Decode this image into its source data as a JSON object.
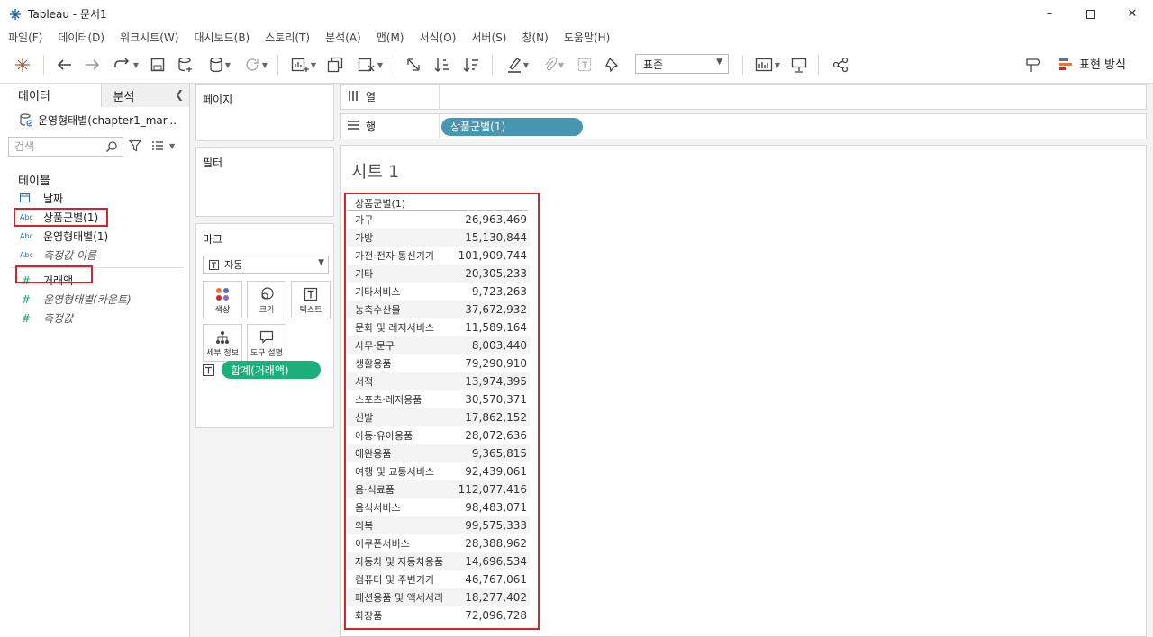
{
  "window": {
    "title": "Tableau - 문서1"
  },
  "menu": [
    "파일(F)",
    "데이터(D)",
    "워크시트(W)",
    "대시보드(B)",
    "스토리(T)",
    "분석(A)",
    "맵(M)",
    "서식(O)",
    "서버(S)",
    "창(N)",
    "도움말(H)"
  ],
  "toolbar": {
    "standard_select": "표준",
    "presentation_label": "표현 방식"
  },
  "data_pane": {
    "tabs": {
      "data": "데이터",
      "analysis": "분석"
    },
    "datasource": "운영형태별(chapter1_mar...",
    "search_placeholder": "검색",
    "tables_title": "테이블",
    "dimensions": [
      {
        "type": "date",
        "type_label": "",
        "name": "날짜"
      },
      {
        "type": "abc",
        "type_label": "Abc",
        "name": "상품군별(1)"
      },
      {
        "type": "abc",
        "type_label": "Abc",
        "name": "운영형태별(1)"
      },
      {
        "type": "abc",
        "type_label": "Abc",
        "name": "측정값 이름"
      }
    ],
    "measures": [
      {
        "type": "#",
        "name": "거래액"
      },
      {
        "type": "#",
        "name": "운영형태별(카운트)"
      },
      {
        "type": "#",
        "name": "측정값"
      }
    ]
  },
  "shelves": {
    "pages": "페이지",
    "filters": "필터",
    "marks": {
      "title": "마크",
      "type": "자동",
      "buttons": {
        "color": "색상",
        "size": "크기",
        "text": "텍스트",
        "detail": "세부 정보",
        "tooltip": "도구 설명"
      },
      "pill": "합계(거래액)"
    },
    "columns_label": "열",
    "rows_label": "행",
    "rows_pill": "상품군별(1)"
  },
  "view": {
    "sheet_title": "시트 1",
    "header": "상품군별(1)",
    "rows": [
      {
        "cat": "가구",
        "val": "26,963,469"
      },
      {
        "cat": "가방",
        "val": "15,130,844"
      },
      {
        "cat": "가전·전자·통신기기",
        "val": "101,909,744"
      },
      {
        "cat": "기타",
        "val": "20,305,233"
      },
      {
        "cat": "기타서비스",
        "val": "9,723,263"
      },
      {
        "cat": "농축수산물",
        "val": "37,672,932"
      },
      {
        "cat": "문화 및 레저서비스",
        "val": "11,589,164"
      },
      {
        "cat": "사무·문구",
        "val": "8,003,440"
      },
      {
        "cat": "생활용품",
        "val": "79,290,910"
      },
      {
        "cat": "서적",
        "val": "13,974,395"
      },
      {
        "cat": "스포츠·레저용품",
        "val": "30,570,371"
      },
      {
        "cat": "신발",
        "val": "17,862,152"
      },
      {
        "cat": "아동·유아용품",
        "val": "28,072,636"
      },
      {
        "cat": "애완용품",
        "val": "9,365,815"
      },
      {
        "cat": "여행 및 교통서비스",
        "val": "92,439,061"
      },
      {
        "cat": "음·식료품",
        "val": "112,077,416"
      },
      {
        "cat": "음식서비스",
        "val": "98,483,071"
      },
      {
        "cat": "의복",
        "val": "99,575,333"
      },
      {
        "cat": "이쿠폰서비스",
        "val": "28,388,962"
      },
      {
        "cat": "자동차 및 자동차용품",
        "val": "14,696,534"
      },
      {
        "cat": "컴퓨터 및 주변기기",
        "val": "46,767,061"
      },
      {
        "cat": "패션용품 및 액세서리",
        "val": "18,277,402"
      },
      {
        "cat": "화장품",
        "val": "72,096,728"
      }
    ]
  },
  "colors": {
    "highlight": "#d9232a",
    "dimension_pill": "#4996b2",
    "measure_pill": "#1bb07a",
    "measure_icon": "#20a070"
  }
}
